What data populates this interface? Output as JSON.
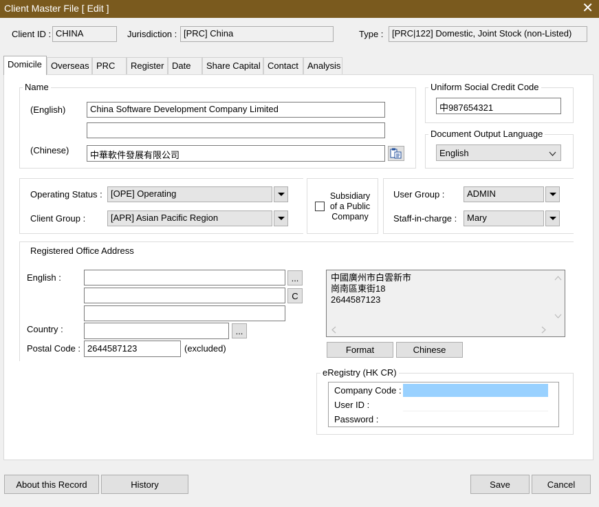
{
  "window": {
    "title": "Client Master File [ Edit ]",
    "close_glyph": "✕"
  },
  "header": {
    "client_id_label": "Client ID :",
    "client_id": "CHINA",
    "jurisdiction_label": "Jurisdiction :",
    "jurisdiction": "[PRC] China",
    "type_label": "Type :",
    "type": "[PRC|122] Domestic, Joint Stock (non-Listed)"
  },
  "tabs": [
    {
      "label": "Domicile"
    },
    {
      "label": "Overseas"
    },
    {
      "label": "PRC"
    },
    {
      "label": "Register"
    },
    {
      "label": "Date"
    },
    {
      "label": "Share Capital"
    },
    {
      "label": "Contact"
    },
    {
      "label": "Analysis"
    }
  ],
  "name_group": {
    "title": "Name",
    "english_label": "(English)",
    "english_value": "China Software Development Company Limited",
    "english_value2": "",
    "chinese_label": "(Chinese)",
    "chinese_value": "中華軟件發展有限公司",
    "copy_icon": "paste-icon"
  },
  "uscc": {
    "title": "Uniform Social Credit Code",
    "value": "中987654321"
  },
  "doc_lang": {
    "title": "Document Output Language",
    "value": "English"
  },
  "status": {
    "operating_label": "Operating Status :",
    "operating_value": "[OPE] Operating",
    "client_group_label": "Client Group :",
    "client_group_value": "[APR] Asian Pacific Region",
    "subsidiary_label": "Subsidiary of a Public Company",
    "user_group_label": "User Group :",
    "user_group_value": "ADMIN",
    "staff_label": "Staff-in-charge :",
    "staff_value": "Mary"
  },
  "address": {
    "title": "Registered Office Address",
    "english_label": "English :",
    "line1": "",
    "line2": "",
    "line3": "",
    "ellipsis": "...",
    "c_button": "C",
    "country_label": "Country :",
    "country_value": "",
    "postal_label": "Postal Code :",
    "postal_value": "2644587123",
    "excluded": "(excluded)",
    "preview_lines": [
      "中國廣州市白雲新市",
      "崗南區東街18",
      "2644587123"
    ],
    "format_button": "Format",
    "chinese_button": "Chinese"
  },
  "eregistry": {
    "title": "eRegistry (HK CR)",
    "company_code_label": "Company Code :",
    "user_id_label": "User ID :",
    "password_label": "Password :"
  },
  "footer": {
    "about_label": "About this Record",
    "history_label": "History",
    "save_label": "Save",
    "cancel_label": "Cancel"
  },
  "colors": {
    "titlebar": "#7a5a1e",
    "highlight": "#99d1ff"
  }
}
